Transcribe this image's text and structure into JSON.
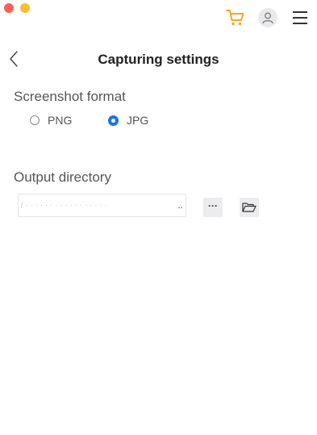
{
  "window": {
    "controls": [
      "close",
      "minimize"
    ]
  },
  "toolbar": {
    "icons": [
      "cart-icon",
      "account-icon",
      "hamburger-menu-icon"
    ],
    "cart_color": "#f5a623"
  },
  "header": {
    "title": "Capturing settings"
  },
  "screenshot_format": {
    "title": "Screenshot format",
    "options": [
      {
        "label": "PNG",
        "selected": false
      },
      {
        "label": "JPG",
        "selected": true
      }
    ],
    "accent_color": "#1a73e8"
  },
  "output_directory": {
    "title": "Output directory",
    "path_value": "/  ·  ·  ·  ·  ·  ·  ·  ·  ·  ·  ·  ·  ·  ·  ·  ·  ·",
    "ellipsis": "..",
    "browse_label": "···"
  }
}
